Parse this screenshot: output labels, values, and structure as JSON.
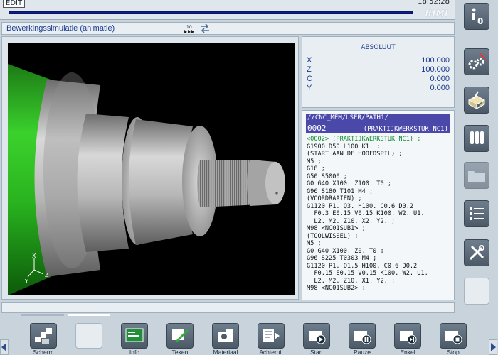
{
  "status": {
    "mode": "EDIT",
    "time": "18:52:28",
    "brand": "iHMI"
  },
  "title": "Bewerkingssimulatie (animatie)",
  "position": {
    "title": "ABSOLUUT",
    "axes": [
      {
        "name": "X",
        "value": "100.000"
      },
      {
        "name": "Z",
        "value": "100.000"
      },
      {
        "name": "C",
        "value": "0.000"
      },
      {
        "name": "Y",
        "value": "0.000"
      }
    ]
  },
  "program": {
    "path": "//CNC_MEM/USER/PATH1/",
    "number": "0002",
    "name": "(PRAKTIJKWERKSTUK NC1)",
    "lines": [
      "<0002> (PRAKTIJKWERKSTUK NC1) ;",
      "G1900 D50 L100 K1. ;",
      "(START AAN DE HOOFDSPIL) ;",
      "M5 ;",
      "G18 ;",
      "G50 S5000 ;",
      "G0 G40 X100. Z100. T0 ;",
      "G96 S180 T101 M4 ;",
      "(VOORDRAAIEN) ;",
      "G1120 P1. Q3. H100. C0.6 D0.2",
      "  F0.3 E0.15 V0.15 K100. W2. U1.",
      "  L2. M2. Z10. X2. Y2. ;",
      "M98 <NC01SUB1> ;",
      "(TOOLWISSEL) ;",
      "M5 ;",
      "G0 G40 X100. Z0. T0 ;",
      "G96 S225 T0303 M4 ;",
      "G1120 P1. Q1.5 H100. C0.6 D0.2",
      "  F0.15 E0.15 V0.15 K100. W2. U1.",
      "  L2. M2. Z10. X1. Y2. ;",
      "M98 <NC01SUB2> ;"
    ]
  },
  "axes_indicator": {
    "x": "X",
    "y": "Y",
    "z": "Z"
  },
  "softkeys": [
    {
      "label": "Scherm",
      "icon": "screen-layout-icon"
    },
    {
      "label": "",
      "icon": ""
    },
    {
      "label": "Info",
      "icon": "info-screen-icon"
    },
    {
      "label": "Teken",
      "icon": "draw-icon"
    },
    {
      "label": "Materiaal",
      "icon": "material-icon"
    },
    {
      "label": "Achteruit",
      "icon": "rewind-icon"
    },
    {
      "label": "Start",
      "icon": "play-icon"
    },
    {
      "label": "Pauze",
      "icon": "pause-icon"
    },
    {
      "label": "Enkel",
      "icon": "single-step-icon"
    },
    {
      "label": "Stop",
      "icon": "stop-icon"
    }
  ],
  "side_keys": [
    "info-icon",
    "settings-gears-icon",
    "workpiece-icon",
    "tools-icon",
    "folder-icon",
    "list-icon",
    "wrench-icon",
    ""
  ],
  "colors": {
    "accent": "#1a3b8f",
    "program_header": "#4a48a8",
    "active_line": "#0a8a2a",
    "progress": "#0d1f8c"
  }
}
